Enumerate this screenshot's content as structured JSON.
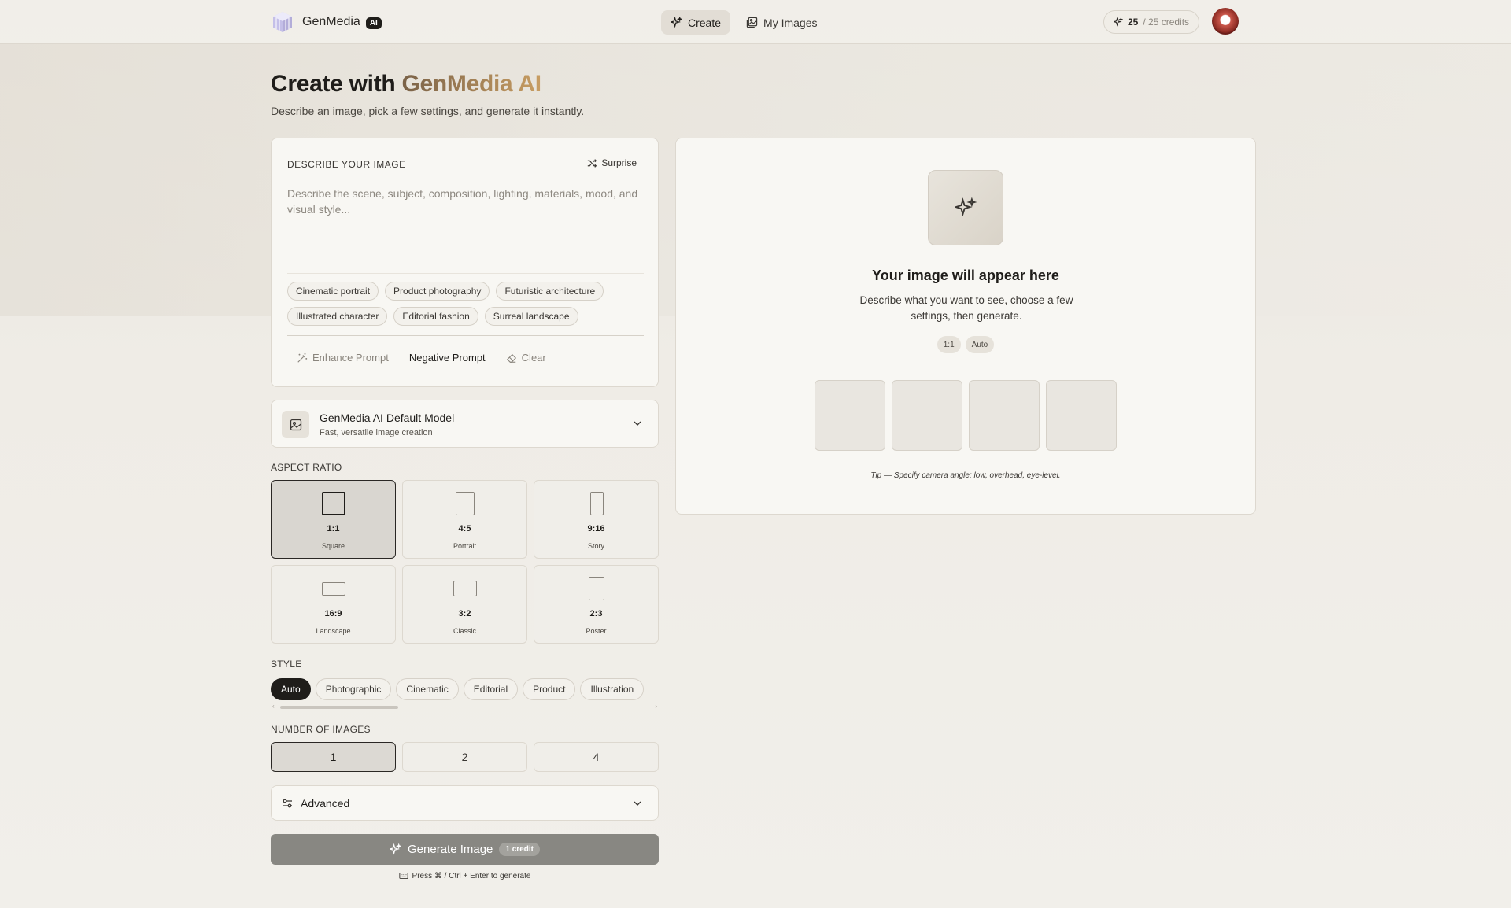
{
  "header": {
    "brand_name": "GenMedia",
    "brand_badge": "AI",
    "nav": [
      {
        "label": "Create",
        "icon": "sparkles-icon",
        "active": true
      },
      {
        "label": "My Images",
        "icon": "images-icon",
        "active": false
      }
    ],
    "credits_value": "25",
    "credits_total": "/ 25 credits"
  },
  "hero": {
    "title_prefix": "Create with ",
    "title_accent": "GenMedia AI",
    "subtitle": "Describe an image, pick a few settings, and generate it instantly."
  },
  "prompt": {
    "section_label": "DESCRIBE YOUR IMAGE",
    "surprise_label": "Surprise",
    "placeholder": "Describe the scene, subject, composition, lighting, materials, mood, and visual style...",
    "value": "",
    "suggestions": [
      "Cinematic portrait",
      "Product photography",
      "Futuristic architecture",
      "Illustrated character",
      "Editorial fashion",
      "Surreal landscape"
    ],
    "actions": {
      "enhance": "Enhance Prompt",
      "negative": "Negative Prompt",
      "clear": "Clear"
    }
  },
  "model": {
    "name": "GenMedia AI Default Model",
    "description": "Fast, versatile image creation"
  },
  "aspect_ratio": {
    "label": "ASPECT RATIO",
    "selected": "1:1",
    "options": [
      {
        "ratio": "1:1",
        "name": "Square"
      },
      {
        "ratio": "4:5",
        "name": "Portrait"
      },
      {
        "ratio": "9:16",
        "name": "Story"
      },
      {
        "ratio": "16:9",
        "name": "Landscape"
      },
      {
        "ratio": "3:2",
        "name": "Classic"
      },
      {
        "ratio": "2:3",
        "name": "Poster"
      }
    ]
  },
  "style": {
    "label": "STYLE",
    "selected": "Auto",
    "options": [
      "Auto",
      "Photographic",
      "Cinematic",
      "Editorial",
      "Product",
      "Illustration"
    ]
  },
  "number_of_images": {
    "label": "NUMBER OF IMAGES",
    "selected": "1",
    "options": [
      "1",
      "2",
      "4"
    ]
  },
  "advanced": {
    "label": "Advanced"
  },
  "generate": {
    "label": "Generate Image",
    "cost": "1 credit",
    "shortcut": "Press ⌘ / Ctrl + Enter to generate"
  },
  "preview": {
    "title": "Your image will appear here",
    "description": "Describe what you want to see, choose a few settings, then generate.",
    "tags": [
      "1:1",
      "Auto"
    ],
    "tip": "Tip — Specify camera angle: low, overhead, eye-level."
  },
  "colors": {
    "accent_start": "#7a6248",
    "accent_end": "#c89d62",
    "dark": "#1f1d1a",
    "generate_disabled": "#888782"
  }
}
